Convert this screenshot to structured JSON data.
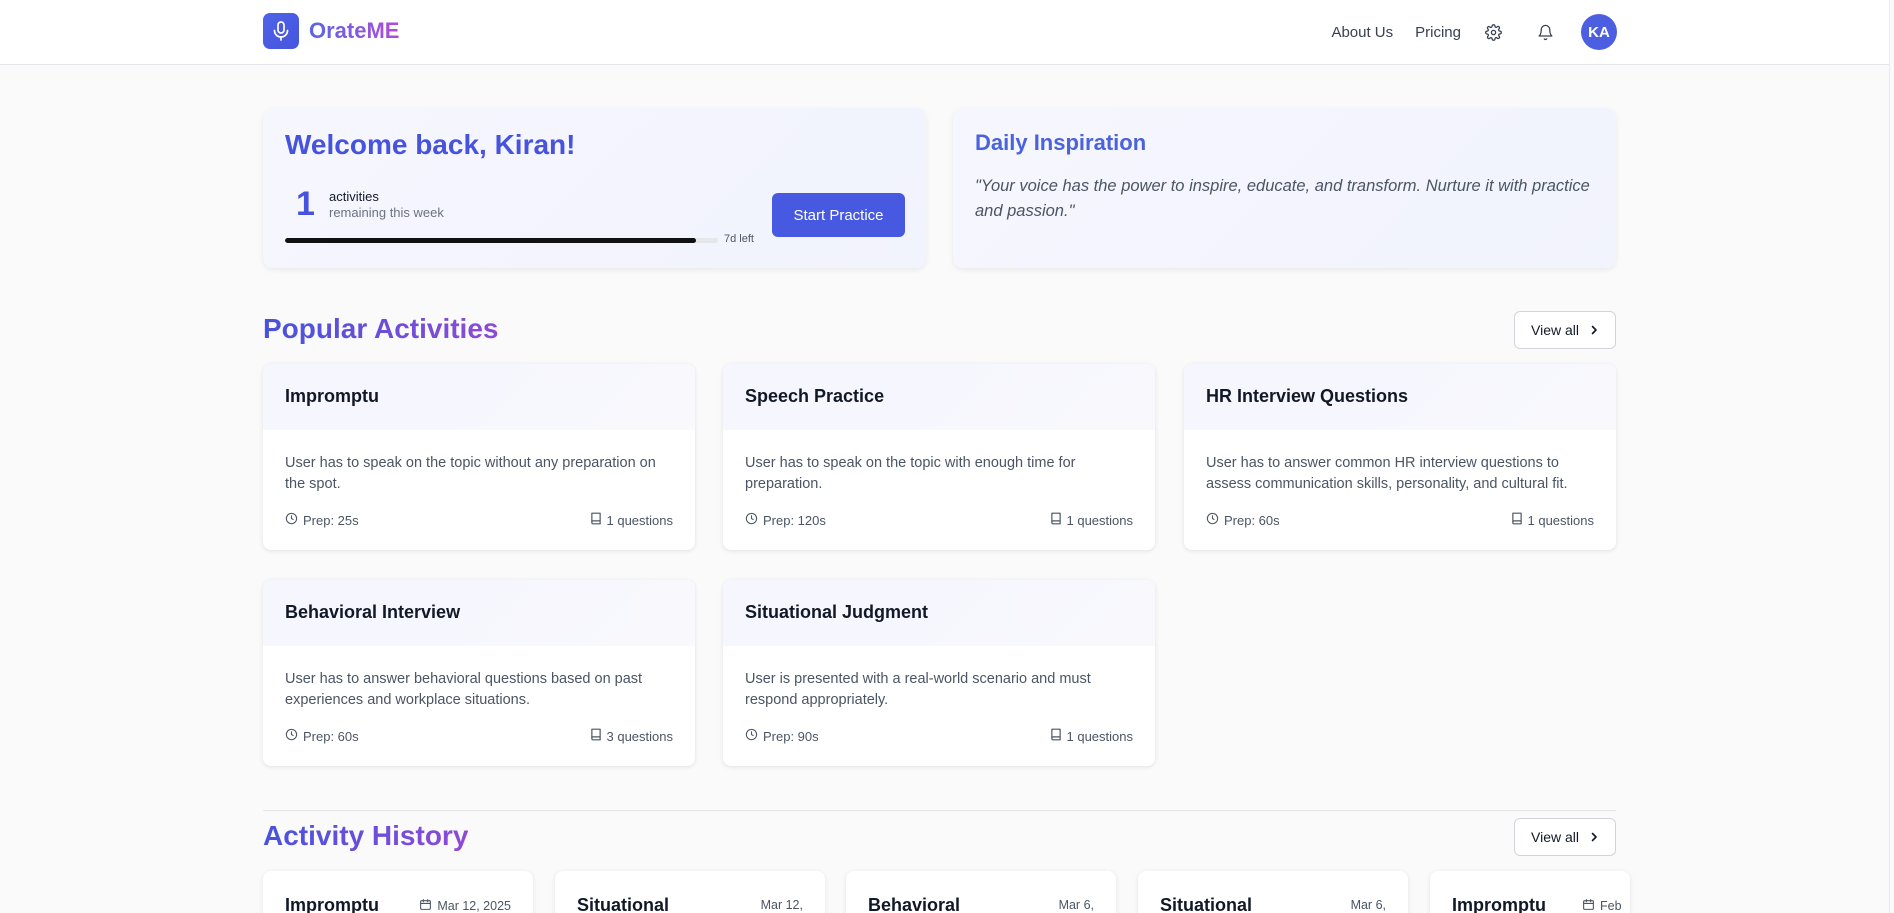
{
  "header": {
    "brand": "OrateME",
    "nav": [
      "About Us",
      "Pricing"
    ],
    "avatar_initials": "KA",
    "icons": [
      "mic-icon",
      "gear-icon",
      "bell-icon"
    ]
  },
  "welcome": {
    "title": "Welcome back, Kiran!",
    "count": "1",
    "count_label": "activities",
    "count_sub": "remaining this week",
    "progress": 0.95,
    "progress_left": "7d left",
    "button": "Start Practice"
  },
  "inspiration": {
    "title": "Daily Inspiration",
    "quote": "\"Your voice has the power to inspire, educate, and transform. Nurture it with practice and passion.\""
  },
  "popular": {
    "title": "Popular Activities",
    "view_all": "View all",
    "items": [
      {
        "title": "Impromptu",
        "desc": "User has to speak on the topic without any preparation on the spot.",
        "prep": "Prep: 25s",
        "questions": "1 questions"
      },
      {
        "title": "Speech Practice",
        "desc": "User has to speak on the topic with enough time for preparation.",
        "prep": "Prep: 120s",
        "questions": "1 questions"
      },
      {
        "title": "HR Interview Questions",
        "desc": "User has to answer common HR interview questions to assess communication skills, personality, and cultural fit.",
        "prep": "Prep: 60s",
        "questions": "1 questions"
      },
      {
        "title": "Behavioral Interview",
        "desc": "User has to answer behavioral questions based on past experiences and workplace situations.",
        "prep": "Prep: 60s",
        "questions": "3 questions"
      },
      {
        "title": "Situational Judgment",
        "desc": "User is presented with a real-world scenario and must respond appropriately.",
        "prep": "Prep: 90s",
        "questions": "1 questions"
      }
    ]
  },
  "history": {
    "title": "Activity History",
    "view_all": "View all",
    "items": [
      {
        "title": "Impromptu",
        "date": "Mar 12, 2025"
      },
      {
        "title": "Situational",
        "date": "Mar 12,"
      },
      {
        "title": "Behavioral",
        "date": "Mar 6,"
      },
      {
        "title": "Situational",
        "date": "Mar 6,"
      },
      {
        "title": "Impromptu",
        "date": "Feb"
      }
    ]
  },
  "colors": {
    "accent": "#4759e0",
    "title_gradient_start": "#4653dd",
    "title_gradient_end": "#8e4ad6"
  }
}
